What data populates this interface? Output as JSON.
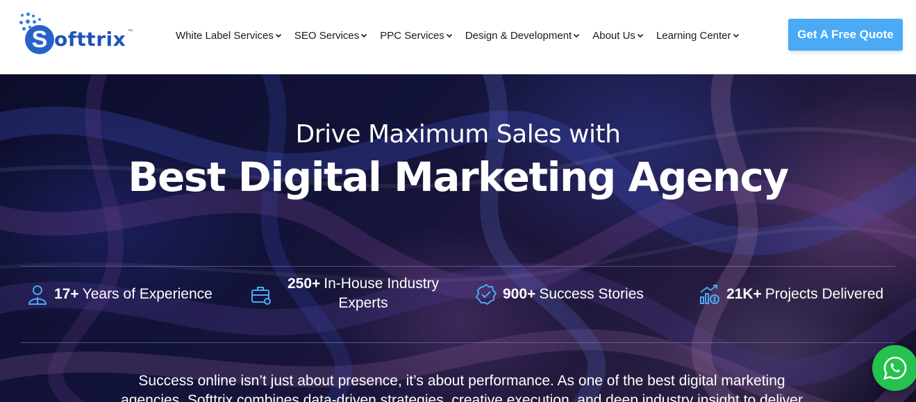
{
  "brand": {
    "name": "Softtrix",
    "tm": "™",
    "color": "#2563c9"
  },
  "nav": {
    "items": [
      {
        "label": "White Label Services"
      },
      {
        "label": "SEO Services"
      },
      {
        "label": "PPC Services"
      },
      {
        "label": "Design & Development"
      },
      {
        "label": "About Us"
      },
      {
        "label": "Learning Center"
      }
    ],
    "cta_label": "Get A Free Quote",
    "cta_color": "#4aaaf5"
  },
  "hero": {
    "subtitle": "Drive Maximum Sales with",
    "title": "Best Digital Marketing Agency",
    "stats": [
      {
        "value": "17+",
        "text": "Years of Experience",
        "icon": "user-badge-icon"
      },
      {
        "value": "250+",
        "text": "In-House Industry",
        "text2": "Experts",
        "icon": "briefcase-icon"
      },
      {
        "value": "900+",
        "text": "Success Stories",
        "icon": "verified-check-icon"
      },
      {
        "value": "21K+",
        "text": "Projects Delivered",
        "icon": "growth-chart-icon"
      }
    ],
    "paragraph_line1": "Success online isn’t just about presence, it’s about performance. As one of the best digital marketing",
    "paragraph_line2": "agencies, Softtrix combines data-driven strategies, creative execution, and deep industry insight to deliver"
  },
  "whatsapp": {
    "icon": "whatsapp-icon",
    "color": "#26c24f"
  }
}
